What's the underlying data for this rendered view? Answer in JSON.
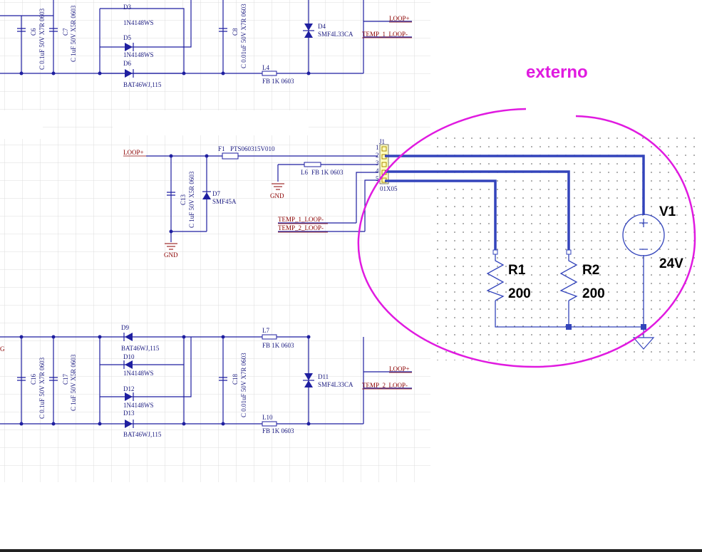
{
  "annotation": {
    "text": "externo",
    "color": "#e01ae0"
  },
  "colors": {
    "wire": "#1f1fa0",
    "net_label": "#8b0000",
    "external_wire": "#3344bb",
    "grid": "#d8d8d8"
  },
  "top_block": {
    "caps": [
      {
        "ref": "C6",
        "value": "C 0.1uF 50V X7R 0603"
      },
      {
        "ref": "C7",
        "value": "C 1uF 50V X5R 0603"
      },
      {
        "ref": "C8",
        "value": "C 0.01uF 50V X7R 0603"
      }
    ],
    "diodes": [
      {
        "ref": "D3",
        "part": "1N4148WS"
      },
      {
        "ref": "D5",
        "part": "1N4148WS"
      },
      {
        "ref": "D6",
        "part": "BAT46WJ,115"
      }
    ],
    "tvs": {
      "ref": "D4",
      "part": "SMF4L33CA"
    },
    "inductor": {
      "ref": "L4",
      "part": "FB 1K 0603"
    },
    "nets": {
      "plus": "LOOP+",
      "minus": "TEMP_1_LOOP-"
    }
  },
  "middle_block": {
    "loop_plus": "LOOP+",
    "fuse": {
      "ref": "F1",
      "part": "PTS060315V010"
    },
    "cap": {
      "ref": "C13",
      "value": "C 1uF 50V X5R 0603"
    },
    "tvs": {
      "ref": "D7",
      "part": "SMF45A"
    },
    "inductor": {
      "ref": "L6",
      "part": "FB 1K 0603"
    },
    "connector": {
      "ref": "J1",
      "part": "01X05",
      "pins": [
        "1",
        "2",
        "3",
        "4",
        "5"
      ]
    },
    "gnd": [
      "GND",
      "GND"
    ],
    "nets": {
      "temp1": "TEMP_1_LOOP-",
      "temp2": "TEMP_2_LOOP-"
    }
  },
  "bottom_block": {
    "net_fragment": "G",
    "caps": [
      {
        "ref": "C16",
        "value": "C 0.1uF 50V X7R 0603"
      },
      {
        "ref": "C17",
        "value": "C 1uF 50V X5R 0603"
      },
      {
        "ref": "C18",
        "value": "C 0.01uF 50V X7R 0603"
      }
    ],
    "diodes": [
      {
        "ref": "D9",
        "part": "BAT46WJ,115"
      },
      {
        "ref": "D10",
        "part": "1N4148WS"
      },
      {
        "ref": "D12",
        "part": "1N4148WS"
      },
      {
        "ref": "D13",
        "part": "BAT46WJ,115"
      }
    ],
    "tvs": {
      "ref": "D11",
      "part": "SMF4L33CA"
    },
    "inductors": [
      {
        "ref": "L7",
        "part": "FB 1K 0603"
      },
      {
        "ref": "L10",
        "part": "FB 1K 0603"
      }
    ],
    "nets": {
      "plus": "LOOP+",
      "minus": "TEMP_2_LOOP-"
    }
  },
  "external_circuit": {
    "r1": {
      "ref": "R1",
      "value": "200"
    },
    "r2": {
      "ref": "R2",
      "value": "200"
    },
    "source": {
      "ref": "V1",
      "value": "24V"
    }
  }
}
